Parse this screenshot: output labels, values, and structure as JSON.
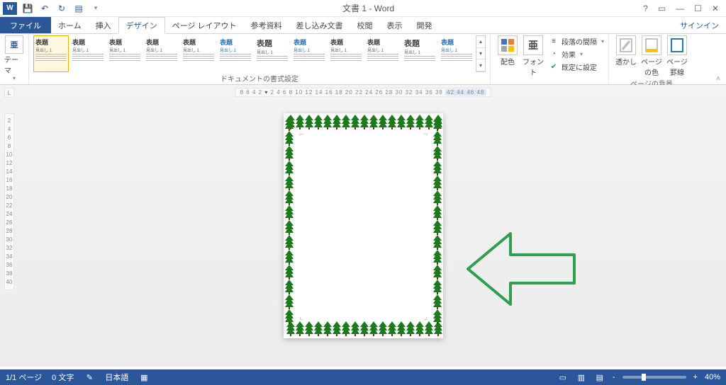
{
  "title": "文書 1 - Word",
  "qat": {
    "save": "save-icon",
    "undo": "undo-icon",
    "redo": "redo-icon",
    "new": "newdoc-icon"
  },
  "wincontrols": {
    "help": "?",
    "ribbonopts": "▭",
    "min": "—",
    "max": "☐",
    "close": "✕"
  },
  "tabs": {
    "file": "ファイル",
    "items": [
      "ホーム",
      "挿入",
      "デザイン",
      "ページ レイアウト",
      "参考資料",
      "差し込み文書",
      "校閲",
      "表示",
      "開発"
    ],
    "active_index": 2,
    "signin": "サインイン"
  },
  "ribbon": {
    "themes_label": "テーマ",
    "themes_kanji": "亜",
    "gallery_title": "表題",
    "gallery_sub": "見出し 1",
    "group_docformat": "ドキュメントの書式設定",
    "colors": "配色",
    "fonts": "フォント",
    "fonts_kanji": "亜",
    "spacing": "段落の間隔",
    "effects": "効果",
    "setdefault": "既定に設定",
    "watermark": "透かし",
    "pagecolor": "ページの色",
    "pageborders": "ページ罫線",
    "group_pagebg": "ページの背景"
  },
  "rulers": {
    "top_left": "8 6 4 2",
    "top_mid": "2  4  6  8 10 12 14 16 18 20 22 24 26 28 30 32 34 36 38",
    "top_right": "42 44 46 48",
    "left": [
      "2",
      "4",
      "6",
      "8",
      "10",
      "12",
      "14",
      "16",
      "18",
      "20",
      "22",
      "24",
      "26",
      "28",
      "30",
      "32",
      "34",
      "36",
      "38",
      "40"
    ]
  },
  "status": {
    "page": "1/1 ページ",
    "words": "0 文字",
    "proof": "proof-icon",
    "lang": "日本語",
    "macro": "macro-icon",
    "zoom_minus": "-",
    "zoom_plus": "+",
    "zoom": "40%"
  }
}
